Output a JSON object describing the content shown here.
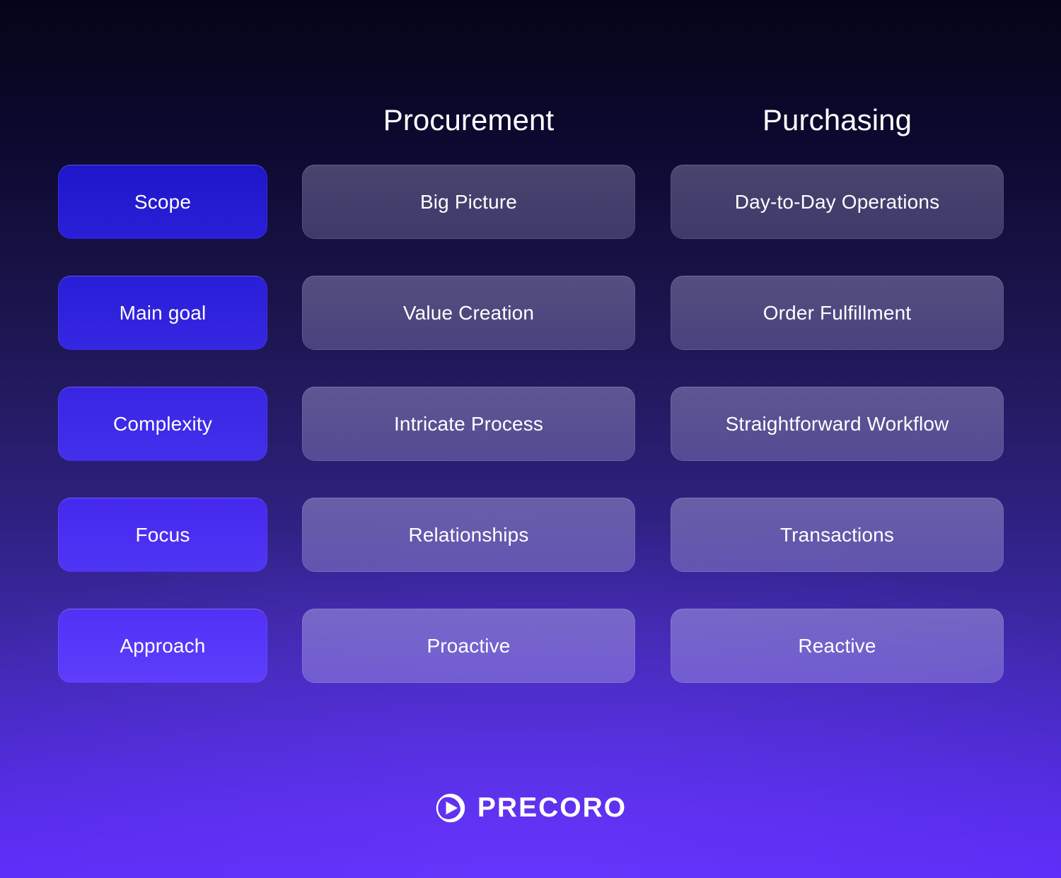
{
  "columns": {
    "label_header": "",
    "mid_header": "Procurement",
    "right_header": "Purchasing"
  },
  "rows": [
    {
      "label": "Scope",
      "procurement": "Big Picture",
      "purchasing": "Day-to-Day Operations"
    },
    {
      "label": "Main goal",
      "procurement": "Value Creation",
      "purchasing": "Order Fulfillment"
    },
    {
      "label": "Complexity",
      "procurement": "Intricate Process",
      "purchasing": "Straightforward Workflow"
    },
    {
      "label": "Focus",
      "procurement": "Relationships",
      "purchasing": "Transactions"
    },
    {
      "label": "Approach",
      "procurement": "Proactive",
      "purchasing": "Reactive"
    }
  ],
  "footer": {
    "brand": "PRECORO",
    "logo_icon": "precoro-pinwheel-icon"
  },
  "colors": {
    "background_top": "#050519",
    "background_bottom": "#5b2cf7",
    "label_pill_top": "#1e17c9",
    "label_pill_bottom": "#5d3efb",
    "value_pill": "rgba(190,186,228,0.35)",
    "text": "#ffffff"
  }
}
